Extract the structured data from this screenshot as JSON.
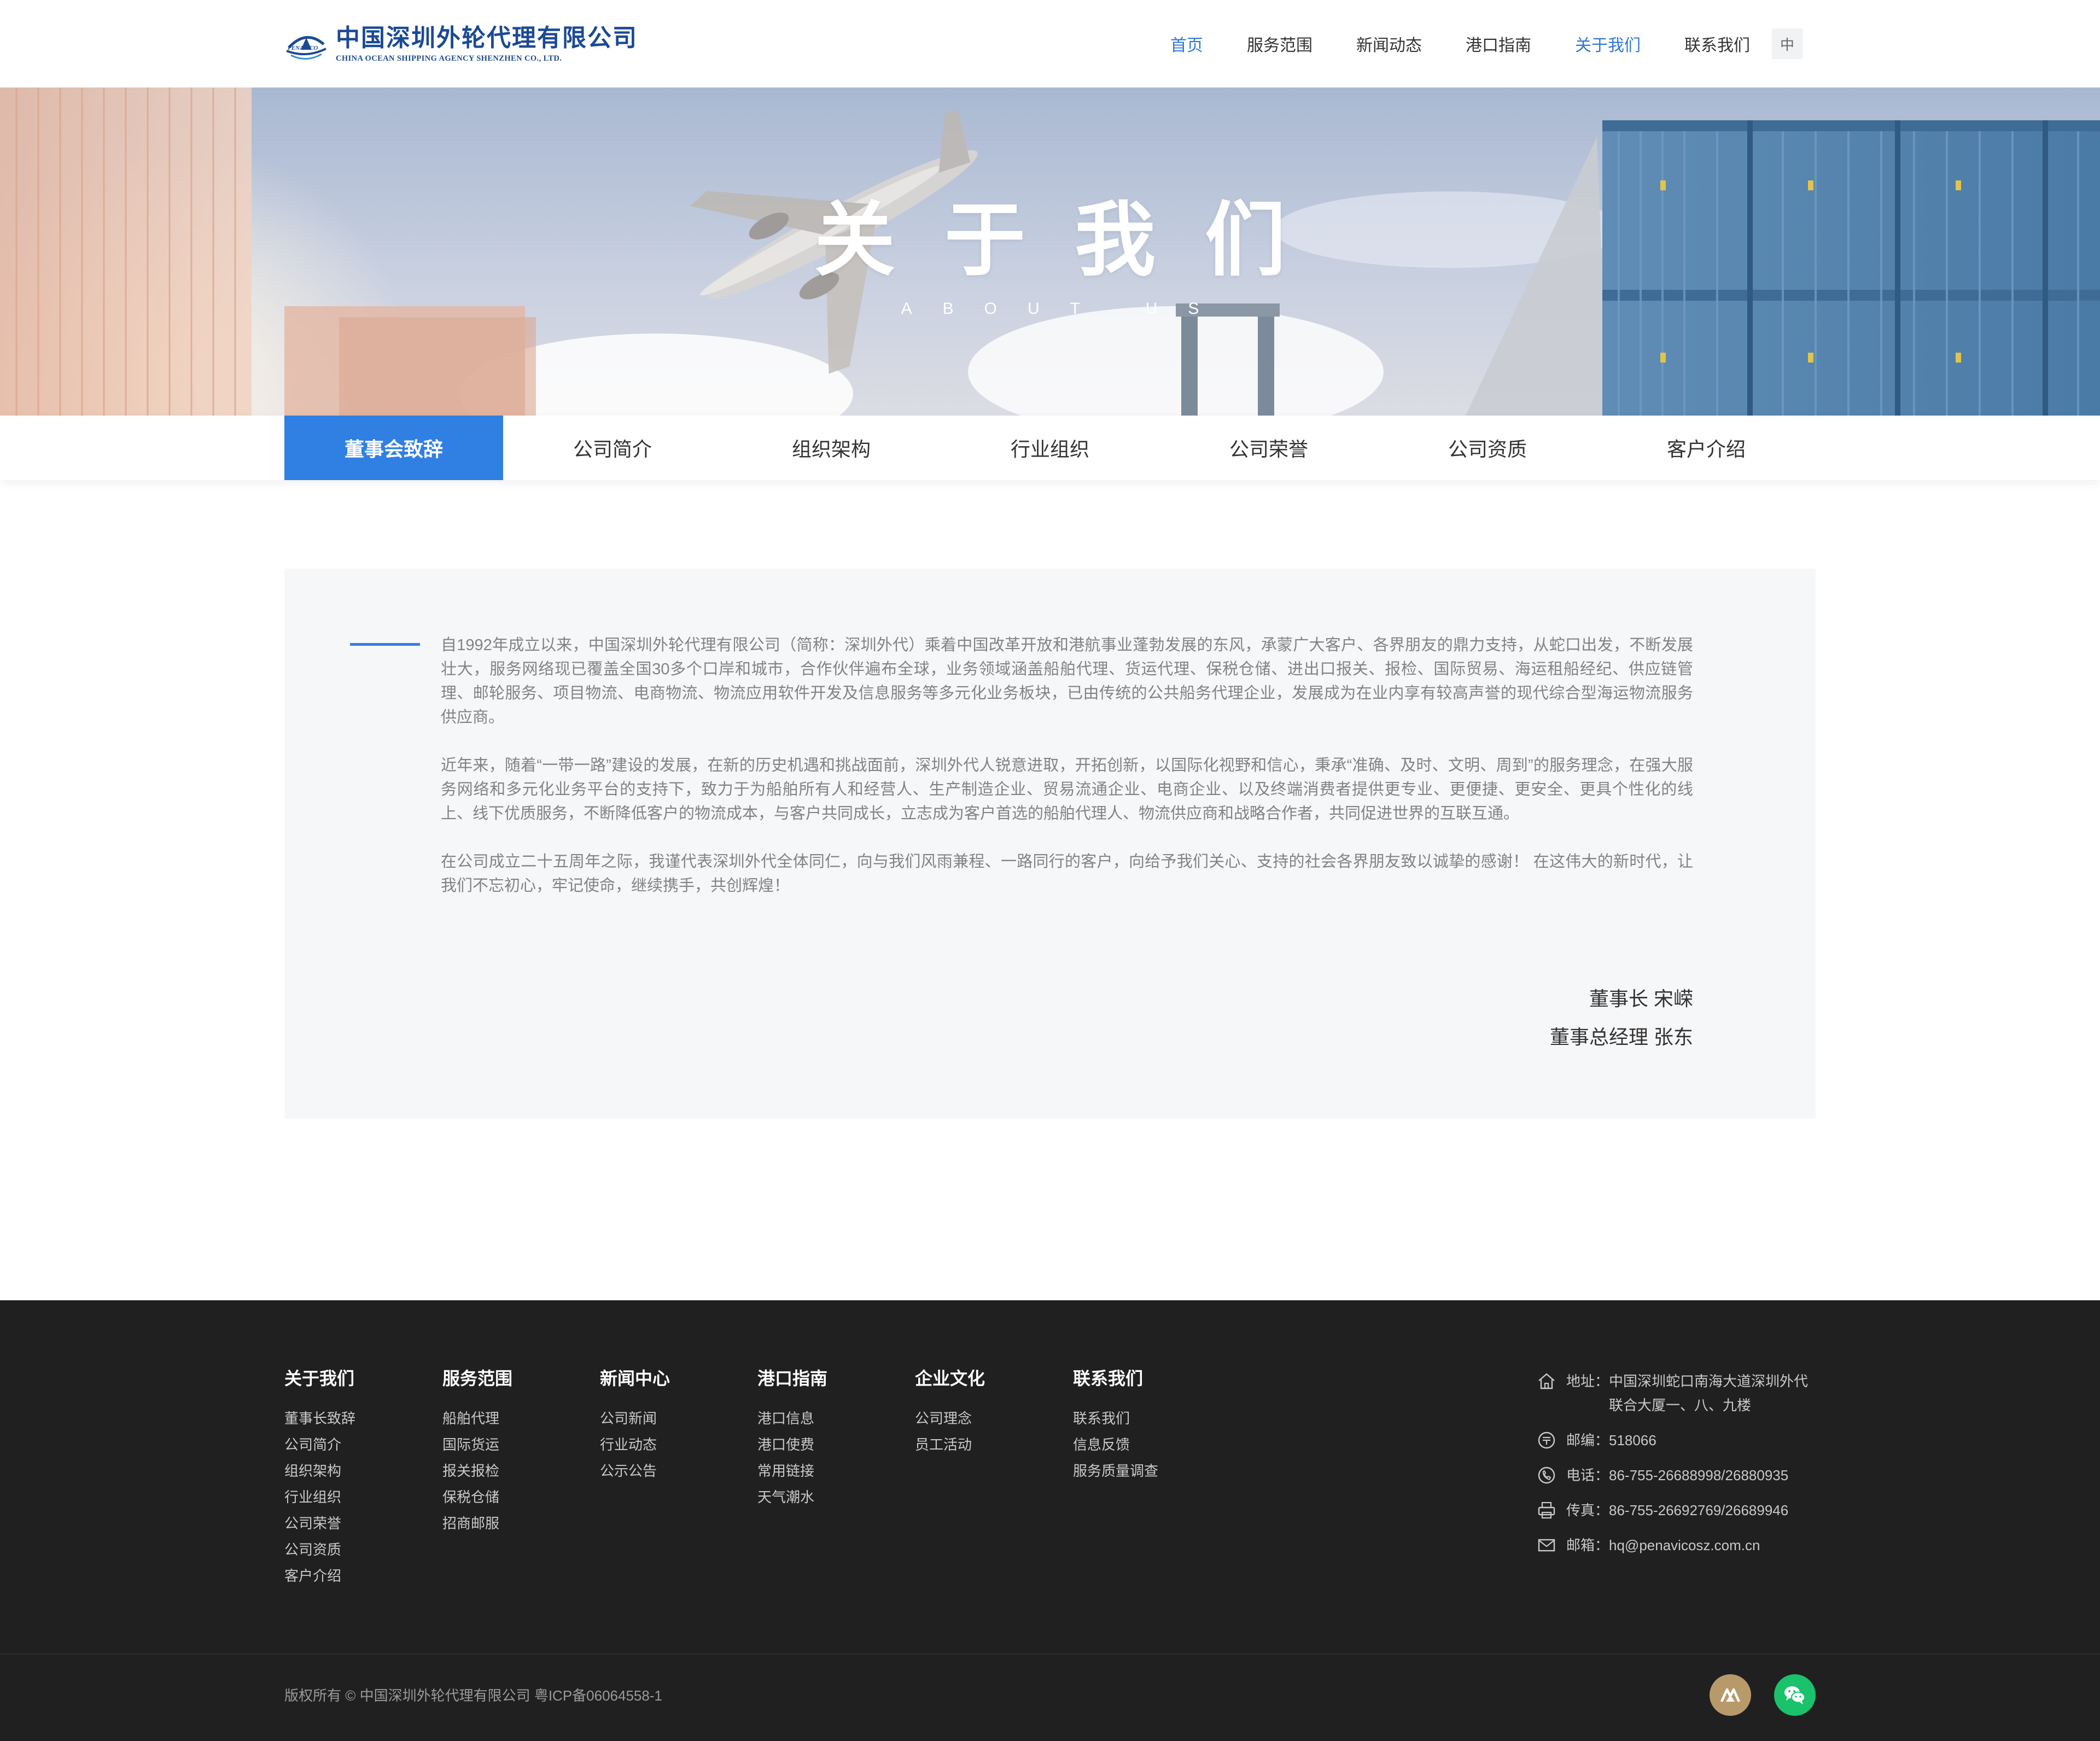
{
  "header": {
    "logo_cn": "中国深圳外轮代理有限公司",
    "logo_en": "CHINA OCEAN SHIPPING AGENCY SHENZHEN CO., LTD.",
    "nav": [
      "首页",
      "服务范围",
      "新闻动态",
      "港口指南",
      "关于我们",
      "联系我们"
    ],
    "active_nav": [
      "首页",
      "关于我们"
    ],
    "lang": "中"
  },
  "banner": {
    "title": "关于我们",
    "subtitle": "ABOUT US"
  },
  "tabs": [
    "董事会致辞",
    "公司简介",
    "组织架构",
    "行业组织",
    "公司荣誉",
    "公司资质",
    "客户介绍"
  ],
  "active_tab": "董事会致辞",
  "content": {
    "paragraphs": [
      "自1992年成立以来，中国深圳外轮代理有限公司（简称：深圳外代）乘着中国改革开放和港航事业蓬勃发展的东风，承蒙广大客户、各界朋友的鼎力支持，从蛇口出发，不断发展壮大，服务网络现已覆盖全国30多个口岸和城市，合作伙伴遍布全球，业务领域涵盖船舶代理、货运代理、保税仓储、进出口报关、报检、国际贸易、海运租船经纪、供应链管理、邮轮服务、项目物流、电商物流、物流应用软件开发及信息服务等多元化业务板块，已由传统的公共船务代理企业，发展成为在业内享有较高声誉的现代综合型海运物流服务供应商。",
      "近年来，随着“一带一路”建设的发展，在新的历史机遇和挑战面前，深圳外代人锐意进取，开拓创新，以国际化视野和信心，秉承“准确、及时、文明、周到”的服务理念，在强大服务网络和多元化业务平台的支持下，致力于为船舶所有人和经营人、生产制造企业、贸易流通企业、电商企业、以及终端消费者提供更专业、更便捷、更安全、更具个性化的线上、线下优质服务，不断降低客户的物流成本，与客户共同成长，立志成为客户首选的船舶代理人、物流供应商和战略合作者，共同促进世界的互联互通。",
      "在公司成立二十五周年之际，我谨代表深圳外代全体同仁，向与我们风雨兼程、一路同行的客户，向给予我们关心、支持的社会各界朋友致以诚挚的感谢！ 在这伟大的新时代，让我们不忘初心，牢记使命，继续携手，共创辉煌！"
    ],
    "signatures": [
      "董事长 宋嵘",
      "董事总经理 张东"
    ]
  },
  "footer": {
    "columns": [
      {
        "title": "关于我们",
        "links": [
          "董事长致辞",
          "公司简介",
          "组织架构",
          "行业组织",
          "公司荣誉",
          "公司资质",
          "客户介绍"
        ]
      },
      {
        "title": "服务范围",
        "links": [
          "船舶代理",
          "国际货运",
          "报关报检",
          "保税仓储",
          "招商邮服"
        ]
      },
      {
        "title": "新闻中心",
        "links": [
          "公司新闻",
          "行业动态",
          "公示公告"
        ]
      },
      {
        "title": "港口指南",
        "links": [
          "港口信息",
          "港口使费",
          "常用链接",
          "天气潮水"
        ]
      },
      {
        "title": "企业文化",
        "links": [
          "公司理念",
          "员工活动"
        ]
      },
      {
        "title": "联系我们",
        "links": [
          "联系我们",
          "信息反馈",
          "服务质量调查"
        ]
      }
    ],
    "contact": [
      {
        "icon": "home-icon",
        "label": "地址：",
        "value": "中国深圳蛇口南海大道深圳外代联合大厦一、八、九楼"
      },
      {
        "icon": "postcode-icon",
        "label": "邮编：",
        "value": "518066"
      },
      {
        "icon": "phone-icon",
        "label": "电话：",
        "value": "86-755-26688998/26880935"
      },
      {
        "icon": "fax-icon",
        "label": "传真：",
        "value": "86-755-26692769/26689946"
      },
      {
        "icon": "mail-icon",
        "label": "邮箱：",
        "value": "hq@penavicosz.com.cn"
      }
    ],
    "copyright": "版权所有 © 中国深圳外轮代理有限公司 粤ICP备06064558-1"
  },
  "colors": {
    "accent": "#2f80e2",
    "nav_active": "#2f78d4",
    "logo": "#1b4a94",
    "footer_bg": "#202020",
    "card_bg": "#f6f7f9",
    "wechat": "#19c26b",
    "social_gold": "#b89a6a"
  }
}
